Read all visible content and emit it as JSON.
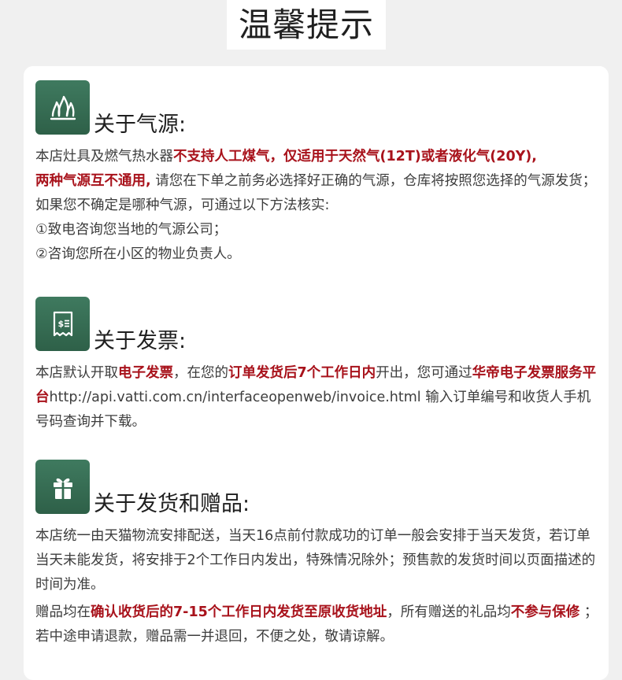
{
  "page_title": "温馨提示",
  "colors": {
    "accent_green": "#3a7559",
    "highlight_red": "#a8121b",
    "background": "#f0f0f0",
    "card": "#ffffff"
  },
  "sections": {
    "gas": {
      "icon": "flame-icon",
      "heading": "关于气源:",
      "p1_t1": "本店灶具及燃气热水器",
      "p1_r1": "不支持人工煤气，仅适用于天然气(12T)或者液化气(20Y),",
      "p1_r2": "两种气源互不通用,",
      "p1_t2": " 请您在下单之前务必选择好正确的气源，仓库将按照您选择的气源发货；如果您不确定是哪种气源，可通过以下方法核实:",
      "item1": "①致电咨询您当地的气源公司；",
      "item2": "②咨询您所在小区的物业负责人。"
    },
    "invoice": {
      "icon": "receipt-dollar-icon",
      "heading": "关于发票:",
      "t1": "本店默认开取",
      "r1": "电子发票",
      "t2": "，在您的",
      "r2": "订单发货后7个工作日内",
      "t3": "开出，您可通过",
      "r3": "华帝电子发票服务平台",
      "t4": "http://api.vatti.com.cn/interfaceopenweb/invoice.html 输入订单编号和收货人手机号码查询并下载。"
    },
    "shipping": {
      "icon": "gift-icon",
      "heading": "关于发货和赠品:",
      "p1": "本店统一由天猫物流安排配送，当天16点前付款成功的订单一般会安排于当天发货，若订单当天未能发货，将安排于2个工作日内发出，特殊情况除外；预售款的发货时间以页面描述的时间为准。",
      "p2_t1": "赠品均在",
      "p2_r1": "确认收货后的7-15个工作日内发货至原收货地址",
      "p2_t2": "，所有赠送的礼品均",
      "p2_r2": "不参与保修",
      "p2_t3": " ；若中途申请退款，赠品需一并退回，不便之处，敬请谅解。"
    }
  }
}
